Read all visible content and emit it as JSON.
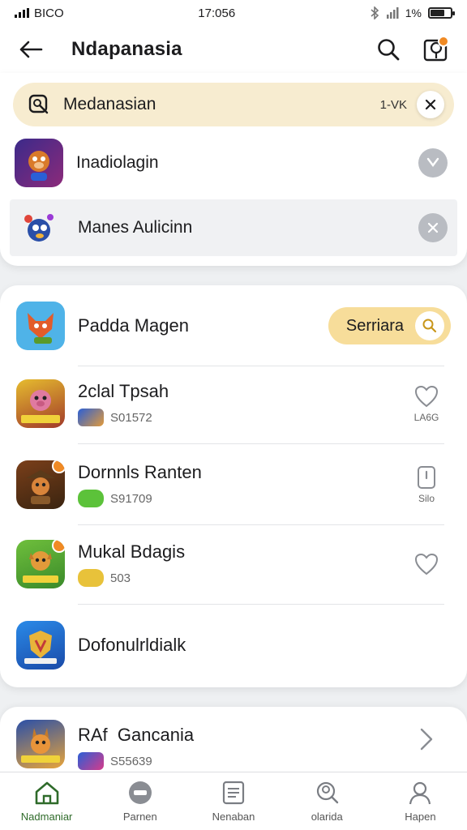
{
  "status_bar": {
    "carrier": "BICO",
    "time": "17:056",
    "battery_text": "1%",
    "battery_level": 0.72
  },
  "header": {
    "title": "Ndapanasia",
    "back_icon": "arrow-left-icon",
    "search_icon": "search-icon",
    "notification_icon": "bell-icon"
  },
  "search": {
    "value": "Medanasian",
    "count": "1-VK",
    "search_icon": "search-icon",
    "clear_icon": "close-icon"
  },
  "recent": [
    {
      "label": "Inadiolagin",
      "icon": "game-monkey-icon"
    },
    {
      "label": "Manes Aulicinn",
      "icon": "game-bird-icon"
    }
  ],
  "results": [
    {
      "title": "Padda Magen",
      "action_label": "Serriara",
      "action_icon": "search-icon",
      "colors": [
        "#4fb3e8",
        "#e25c2a"
      ]
    },
    {
      "title": "2clal Tpsah",
      "sub": "S01572",
      "action_label": "LA6G",
      "action_icon": "heart-icon",
      "colors": [
        "#e6bc2f",
        "#c23a3a"
      ]
    },
    {
      "title": "Dornnls Ranten",
      "sub": "S91709",
      "action_label": "Silo",
      "action_icon": "phone-icon",
      "colors": [
        "#7a3f1a",
        "#d9843a"
      ]
    },
    {
      "title": "Mukal Bdagis",
      "sub": "503",
      "action_label": "",
      "action_icon": "heart-icon",
      "colors": [
        "#6fbf3c",
        "#e29a3a"
      ]
    },
    {
      "title": "Dofonulrldialk",
      "colors": [
        "#2a6fd6",
        "#e8b43a"
      ]
    }
  ],
  "bottom_item": {
    "title": "RAf  Gancania",
    "sub": "S55639",
    "chevron_icon": "chevron-right-icon"
  },
  "tabs": [
    {
      "label": "Nadmaniar",
      "icon": "home-icon",
      "active": true
    },
    {
      "label": "Parnen",
      "icon": "minus-circle-icon",
      "active": false
    },
    {
      "label": "Nenaban",
      "icon": "document-icon",
      "active": false
    },
    {
      "label": "olarida",
      "icon": "profile-search-icon",
      "active": false
    },
    {
      "label": "Hapen",
      "icon": "user-icon",
      "active": false
    }
  ],
  "colors": {
    "accent": "#2f6b2a",
    "search_bg": "#f7ecd0",
    "pill_bg": "#f7dd9a",
    "badge": "#f08a24"
  }
}
